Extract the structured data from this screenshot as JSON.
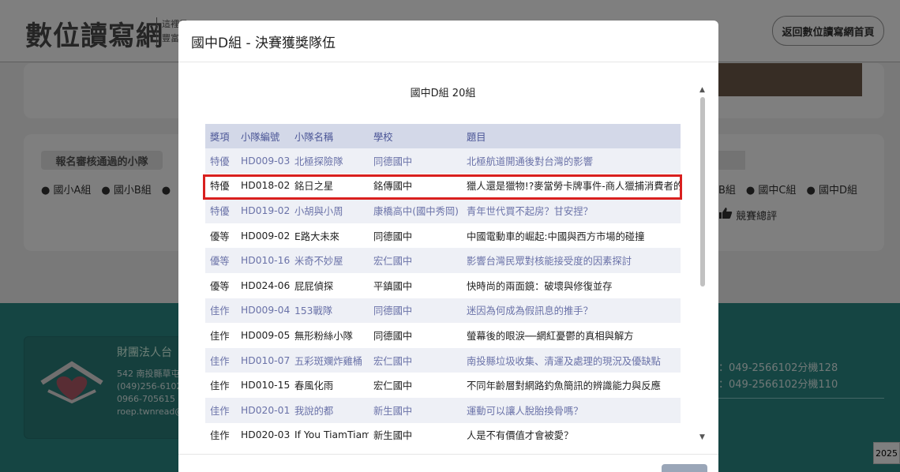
{
  "site": {
    "logo": "數位讀寫網",
    "logo_sub_1": "這裡是",
    "logo_sub_2": "豐富的",
    "home_button": "返回數位讀寫網首頁"
  },
  "background": {
    "reg_tag": "報名審核通過的小隊",
    "groups_left": "● 國小A組　● 國小B組　●",
    "groups_right": "B組　● 國中C組　● 國中D組",
    "review_link": "競賽總評",
    "org": "財團法人台",
    "info": [
      "542 南投縣草屯",
      "(049)256-6102",
      "0966-705615",
      "roep.twnread@"
    ],
    "phones": [
      "：049-2566102分機128",
      "：049-2566102分機110"
    ],
    "year": "2025"
  },
  "modal": {
    "title": "國中D組 - 決賽獲獎隊伍",
    "subtitle": "國中D組 20組",
    "headers": [
      "獎項",
      "小隊編號",
      "小隊名稱",
      "學校",
      "題目"
    ],
    "rows": [
      [
        "特優",
        "HD009-03",
        "北極探險隊",
        "同德國中",
        "北極航道開通後對台灣的影響"
      ],
      [
        "特優",
        "HD018-02",
        "銘日之星",
        "銘傳國中",
        "獵人還是獵物!?麥當勞卡牌事件-商人獵捕消費者的市"
      ],
      [
        "特優",
        "HD019-02",
        "小胡與小周",
        "康橋高中(國中秀岡)",
        "青年世代買不起房？甘安捏？"
      ],
      [
        "優等",
        "HD009-02",
        "E路大未來",
        "同德國中",
        "中國電動車的崛起:中國與西方市場的碰撞"
      ],
      [
        "優等",
        "HD010-16",
        "米奇不妙屋",
        "宏仁國中",
        "影響台灣民眾對核能接受度的因素探討"
      ],
      [
        "優等",
        "HD024-06",
        "屁屁偵探",
        "平鎮國中",
        "快時尚的兩面鏡：破壞與修復並存"
      ],
      [
        "佳作",
        "HD009-04",
        "153戰隊",
        "同德國中",
        "迷因為何成為假訊息的推手？"
      ],
      [
        "佳作",
        "HD009-05",
        "無形粉絲小隊",
        "同德國中",
        "螢幕後的眼淚──網紅憂鬱的真相與解方"
      ],
      [
        "佳作",
        "HD010-07",
        "五彩斑斕炸雞桶",
        "宏仁國中",
        "南投縣垃圾收集、清運及處理的現況及優缺點"
      ],
      [
        "佳作",
        "HD010-15",
        "春風化雨",
        "宏仁國中",
        "不同年齡層對網路釣魚簡訊的辨識能力與反應"
      ],
      [
        "佳作",
        "HD020-01",
        "我說的都",
        "新生國中",
        "運動可以讓人脫胎換骨嗎？"
      ],
      [
        "佳作",
        "HD020-03",
        "If You TiamTiam",
        "新生國中",
        "人是不有價值才會被愛？"
      ]
    ]
  }
}
